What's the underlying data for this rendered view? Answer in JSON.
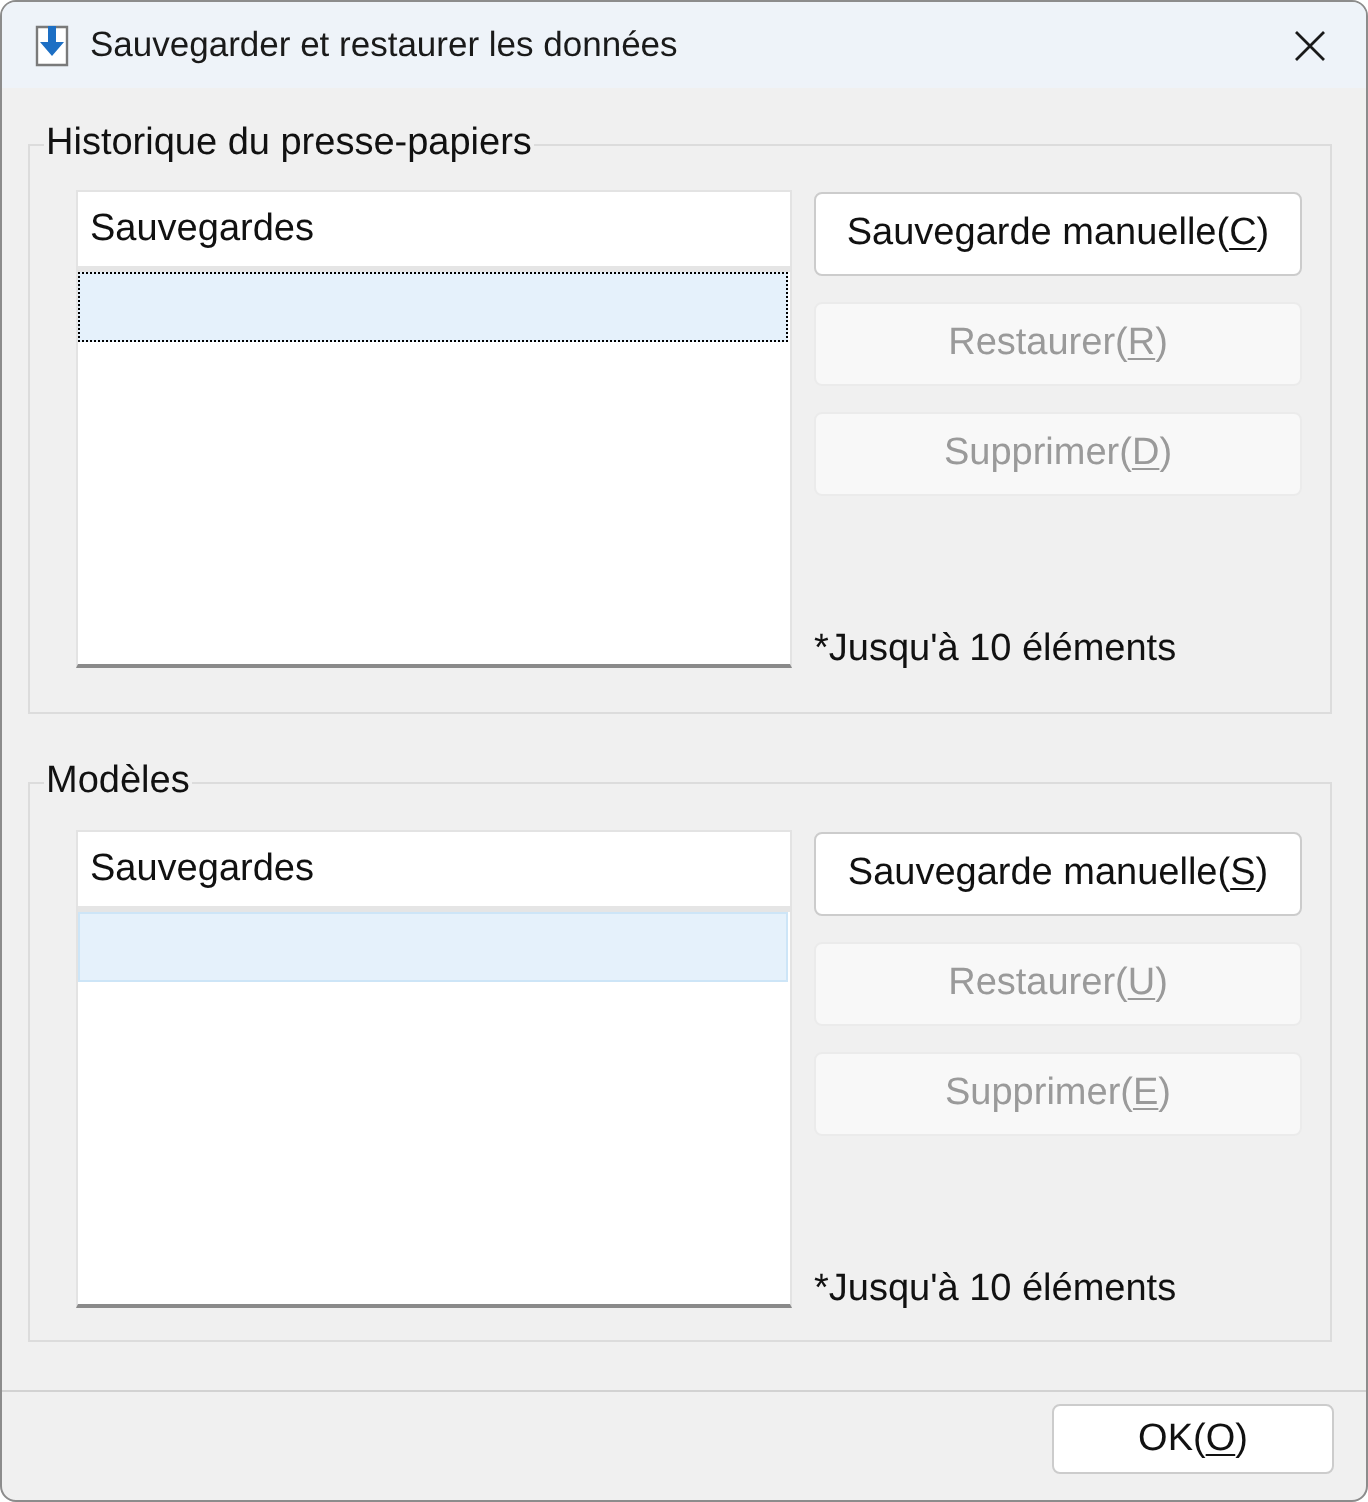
{
  "window": {
    "title": "Sauvegarder et restaurer les données"
  },
  "groups": [
    {
      "title": "Historique du presse-papiers",
      "list": {
        "columns": [
          "Sauvegardes"
        ],
        "rows": [
          {
            "selected": true,
            "focused": true
          }
        ]
      },
      "buttons": [
        {
          "text_before": "Sauvegarde manuelle(",
          "access_key": "C",
          "text_after": ")",
          "disabled": false
        },
        {
          "text_before": "Restaurer(",
          "access_key": "R",
          "text_after": ")",
          "disabled": true
        },
        {
          "text_before": "Supprimer(",
          "access_key": "D",
          "text_after": ")",
          "disabled": true
        }
      ],
      "note": "*Jusqu'à 10 éléments"
    },
    {
      "title": "Modèles",
      "list": {
        "columns": [
          "Sauvegardes"
        ],
        "rows": [
          {
            "selected": true,
            "focused": false
          }
        ]
      },
      "buttons": [
        {
          "text_before": "Sauvegarde manuelle(",
          "access_key": "S",
          "text_after": ")",
          "disabled": false
        },
        {
          "text_before": "Restaurer(",
          "access_key": "U",
          "text_after": ")",
          "disabled": true
        },
        {
          "text_before": "Supprimer(",
          "access_key": "E",
          "text_after": ")",
          "disabled": true
        }
      ],
      "note": "*Jusqu'à 10 éléments"
    }
  ],
  "footer": {
    "buttons": [
      {
        "text_before": "OK(",
        "access_key": "O",
        "text_after": ")",
        "disabled": false
      }
    ]
  }
}
